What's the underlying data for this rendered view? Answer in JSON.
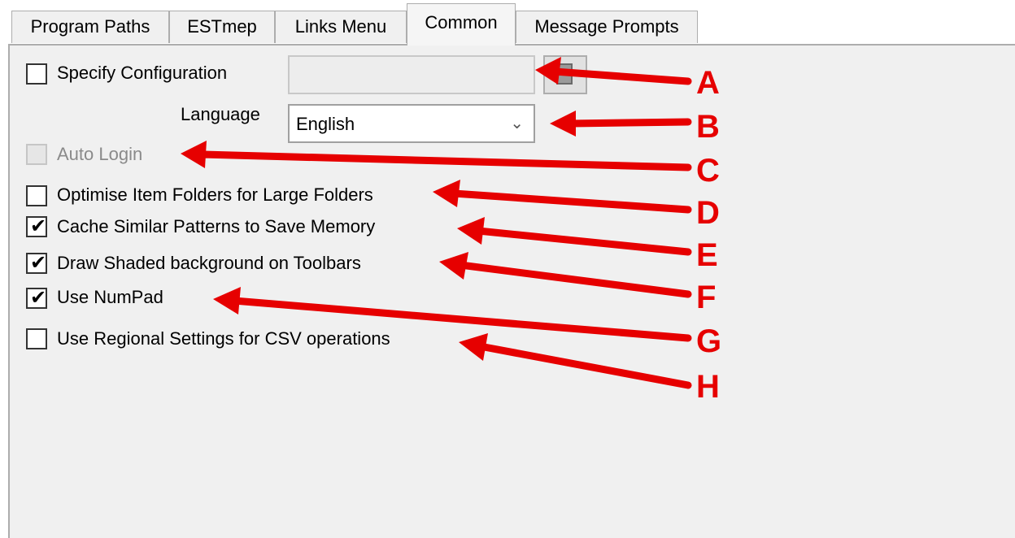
{
  "tabs": [
    {
      "label": "Program Paths",
      "active": false
    },
    {
      "label": "ESTmep",
      "active": false
    },
    {
      "label": "Links Menu",
      "active": false
    },
    {
      "label": "Common",
      "active": true
    },
    {
      "label": "Message Prompts",
      "active": false
    }
  ],
  "config": {
    "label": "Specify Configuration",
    "checked": false,
    "path_value": "",
    "browse_icon": "folder-browse-icon"
  },
  "language": {
    "label": "Language",
    "selected": "English",
    "chevron": "⌄"
  },
  "options": [
    {
      "label": "Auto Login",
      "checked": false,
      "disabled": true
    },
    {
      "label": "Optimise Item Folders for Large Folders",
      "checked": false,
      "disabled": false
    },
    {
      "label": "Cache Similar Patterns to Save Memory",
      "checked": true,
      "disabled": false
    },
    {
      "label": "Draw Shaded background on Toolbars",
      "checked": true,
      "disabled": false
    },
    {
      "label": "Use NumPad",
      "checked": true,
      "disabled": false
    },
    {
      "label": "Use Regional Settings for CSV operations",
      "checked": false,
      "disabled": false
    }
  ],
  "callouts": [
    "A",
    "B",
    "C",
    "D",
    "E",
    "F",
    "G",
    "H"
  ],
  "colors": {
    "annotation": "#e60000",
    "panel": "#f0f0f0",
    "border": "#adadad"
  }
}
